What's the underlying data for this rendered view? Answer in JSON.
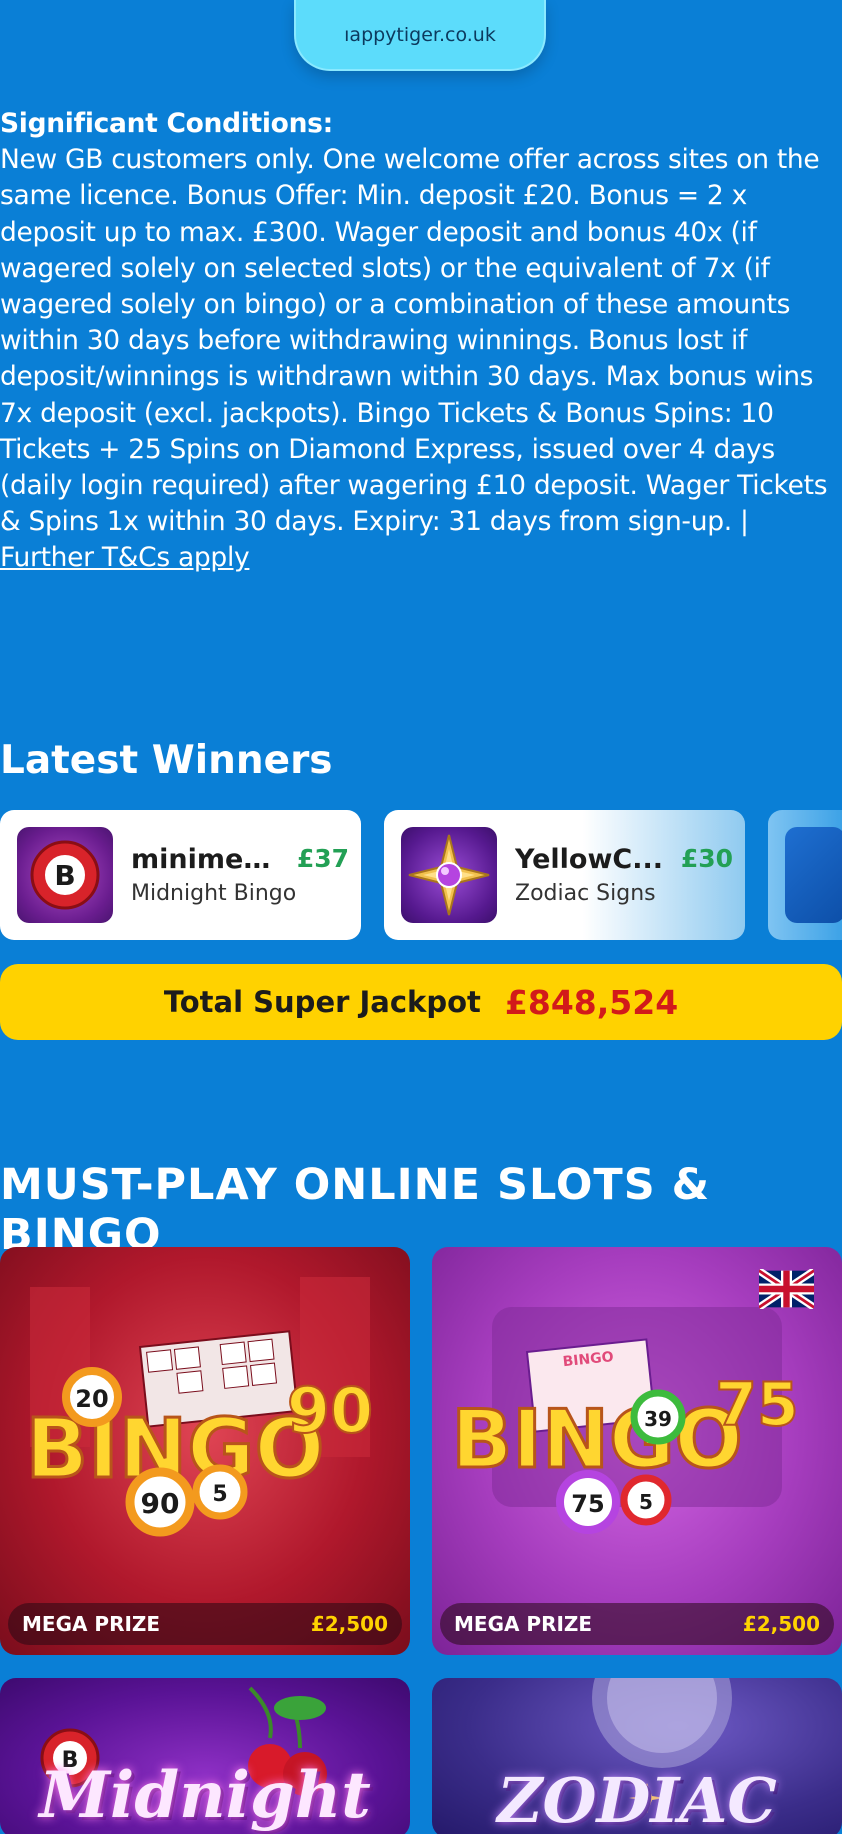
{
  "top": {
    "url": "ıappytiger.co.uk"
  },
  "conditions": {
    "title": "Significant Conditions:",
    "body": "New GB customers only. One welcome offer across sites on the same licence. Bonus Offer: Min. deposit £20. Bonus = 2 x deposit up to max. £300. Wager deposit and bonus 40x (if wagered solely on selected slots) or the equivalent of 7x (if wagered solely on bingo) or a combination of these amounts within 30 days before withdrawing winnings. Bonus lost if deposit/winnings is withdrawn within 30 days. Max bonus wins 7x deposit (excl. jackpots). Bingo Tickets & Bonus Spins: 10 Tickets + 25 Spins on Diamond Express, issued over 4 days (daily login required) after wagering £10 deposit. Wager Tickets & Spins 1x within 30 days. Expiry: 31 days from sign-up. |",
    "link": "Further T&Cs apply"
  },
  "latest_winners": {
    "title": "Latest Winners",
    "items": [
      {
        "name": "minime1...",
        "amount": "£37",
        "game": "Midnight Bingo",
        "icon": "bingo-ball-icon"
      },
      {
        "name": "YellowC...",
        "amount": "£30",
        "game": "Zodiac Signs",
        "icon": "star-gem-icon"
      }
    ]
  },
  "jackpot": {
    "label": "Total Super Jackpot",
    "value": "£848,524"
  },
  "must_play": {
    "title": "Must-Play Online Slots & Bingo",
    "tiles": [
      {
        "prize_label": "MEGA PRIZE",
        "prize_value": "£2,500"
      },
      {
        "prize_label": "MEGA PRIZE",
        "prize_value": "£2,500"
      },
      {
        "title": "Midnight"
      },
      {
        "title": "ZODIAC"
      }
    ]
  },
  "colors": {
    "background": "#0a7fd6",
    "jackpot_yellow": "#ffd200",
    "jackpot_red": "#d21a1a",
    "win_green": "#23a055"
  }
}
